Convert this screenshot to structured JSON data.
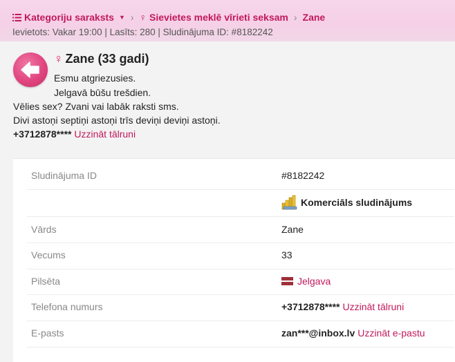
{
  "breadcrumb": {
    "category_list": "Kategoriju saraksts",
    "section": "Sievietes meklē vīrieti seksam",
    "current": "Zane"
  },
  "meta": "Ievietots: Vakar 19:00 | Lasīts: 280 | Sludinājuma ID: #8182242",
  "listing": {
    "title": "Zane (33 gadi)",
    "desc_lines": [
      "Esmu atgriezusies.",
      "Jelgavā būšu trešdien.",
      "Vēlies sex? Zvani vai labāk raksti sms.",
      "Divi astoņi septiņi astoņi trīs deviņi deviņi astoņi."
    ],
    "phone_masked": "+3712878****",
    "phone_link": "Uzzināt tālruni"
  },
  "details": {
    "id_label": "Sludinājuma ID",
    "id_value": "#8182242",
    "commercial_value": "Komerciāls sludinājums",
    "name_label": "Vārds",
    "name_value": "Zane",
    "age_label": "Vecums",
    "age_value": "33",
    "city_label": "Pilsēta",
    "city_value": "Jelgava",
    "phone_label": "Telefona numurs",
    "phone_value": "+3712878****",
    "phone_link": "Uzzināt tālruni",
    "email_label": "E-pasts",
    "email_value": "zan***@inbox.lv",
    "email_link": "Uzzināt e-pastu"
  },
  "colors": {
    "accent": "#c2185b",
    "header_bg": "#f5d0e6",
    "back_button": "#e1457f"
  }
}
